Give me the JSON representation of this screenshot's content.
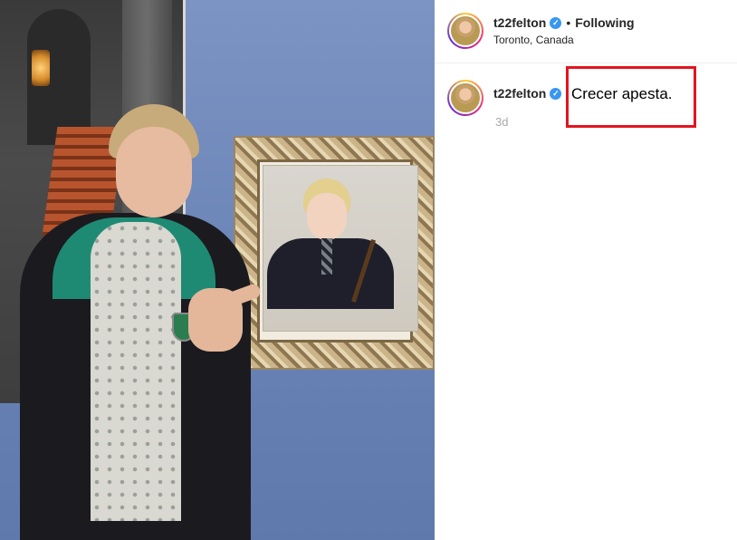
{
  "post": {
    "username": "t22felton",
    "verified_icon": "verified-badge-icon",
    "separator": "•",
    "follow_status": "Following",
    "location": "Toronto, Canada"
  },
  "comment": {
    "username": "t22felton",
    "text": "Crecer apesta.",
    "time": "3d",
    "highlight_color": "#e3141e"
  },
  "colors": {
    "verified": "#3897f0",
    "wall": "#6f87b8"
  }
}
